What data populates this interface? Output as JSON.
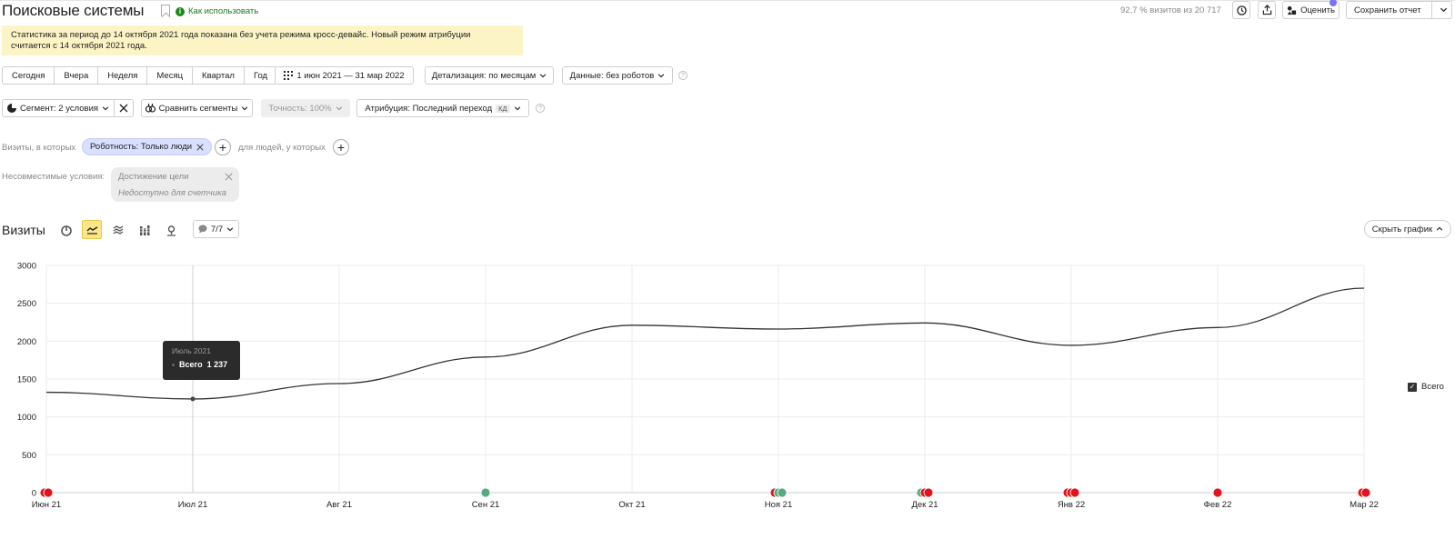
{
  "header": {
    "title": "Поисковые системы",
    "howto": "Как использовать",
    "visits_share": "92,7 % визитов из 20 717",
    "rate_label": "Оценить",
    "save_label": "Сохранить отчет"
  },
  "notice": {
    "line1": "Статистика за период до 14 октября 2021 года показана без учета режима кросс-девайс. Новый режим атрибуции",
    "line2": "считается с 14 октября 2021 года."
  },
  "periods": [
    "Сегодня",
    "Вчера",
    "Неделя",
    "Месяц",
    "Квартал",
    "Год"
  ],
  "date_range": "1 июн 2021 — 31 мар 2022",
  "detail": "Детализация: по месяцам",
  "data_filter": "Данные: без роботов",
  "segment": {
    "label": "Сегмент: 2 условия",
    "compare": "Сравнить сегменты",
    "accuracy": "Точность: 100%",
    "attribution": "Атрибуция: Последний переход",
    "attribution_badge": "КД"
  },
  "conditions": {
    "visits_label": "Визиты, в которых",
    "chip": "Роботность: Только люди",
    "people_label": "для людей, у которых",
    "incompat_label": "Несовместимые условия:",
    "incompat_goal": "Достижение цели",
    "incompat_note": "Недоступно для счетчика"
  },
  "chart_header": {
    "title": "Визиты",
    "notes_count": "7/7",
    "hide_label": "Скрыть график"
  },
  "tooltip": {
    "title": "Июль 2021",
    "series": "Всего",
    "value": "1 237"
  },
  "chart_data": {
    "type": "line",
    "categories": [
      "Июн 21",
      "Июл 21",
      "Авг 21",
      "Сен 21",
      "Окт 21",
      "Ноя 21",
      "Дек 21",
      "Янв 22",
      "Фев 22",
      "Мар 22"
    ],
    "series": [
      {
        "name": "Всего",
        "values": [
          1325,
          1237,
          1440,
          1790,
          2210,
          2160,
          2240,
          1945,
          2180,
          2700
        ]
      }
    ],
    "yticks": [
      0,
      500,
      1000,
      1500,
      2000,
      2500,
      3000
    ],
    "ylim": [
      0,
      3000
    ],
    "grid": true,
    "legend": "right",
    "line_color": "#333333",
    "annotations": [
      {
        "x": "Июн 21",
        "markers": [
          "red",
          "red"
        ]
      },
      {
        "x": "Сен 21",
        "markers": [
          "green"
        ]
      },
      {
        "x": "Ноя 21",
        "markers": [
          "red",
          "green",
          "green"
        ]
      },
      {
        "x": "Дек 21",
        "markers": [
          "green",
          "red",
          "red"
        ]
      },
      {
        "x": "Янв 22",
        "markers": [
          "red",
          "red",
          "red"
        ]
      },
      {
        "x": "Фев 22",
        "markers": [
          "red"
        ]
      },
      {
        "x": "Мар 22",
        "markers": [
          "red",
          "red"
        ]
      }
    ],
    "colors": {
      "red": "#e0141e",
      "green": "#5aa882"
    }
  }
}
